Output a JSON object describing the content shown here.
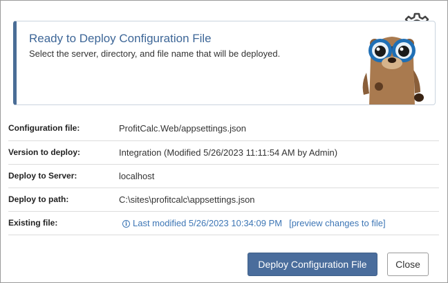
{
  "banner": {
    "title": "Ready to Deploy Configuration File",
    "subtitle": "Select the server, directory, and file name that will be deployed."
  },
  "details": [
    {
      "label": "Configuration file:",
      "value": "ProfitCalc.Web/appsettings.json"
    },
    {
      "label": "Version to deploy:",
      "value": "Integration (Modified 5/26/2023 11:11:54 AM by Admin)"
    },
    {
      "label": "Deploy to Server:",
      "value": "localhost"
    },
    {
      "label": "Deploy to path:",
      "value": "C:\\sites\\profitcalc\\appsettings.json"
    }
  ],
  "existing_file": {
    "label": "Existing file:",
    "info_icon_glyph": "i",
    "last_modified": "Last modified 5/26/2023 10:34:09 PM",
    "preview_link": "[preview changes to file]"
  },
  "buttons": {
    "deploy": "Deploy Configuration File",
    "close": "Close"
  },
  "icons": {
    "settings": "gear-play-icon",
    "mascot": "otter-mascot-with-goggles"
  },
  "colors": {
    "accent": "#4a6d96",
    "title": "#3d6697",
    "link": "#3d76b5",
    "primary_button": "#4a6d9c"
  }
}
